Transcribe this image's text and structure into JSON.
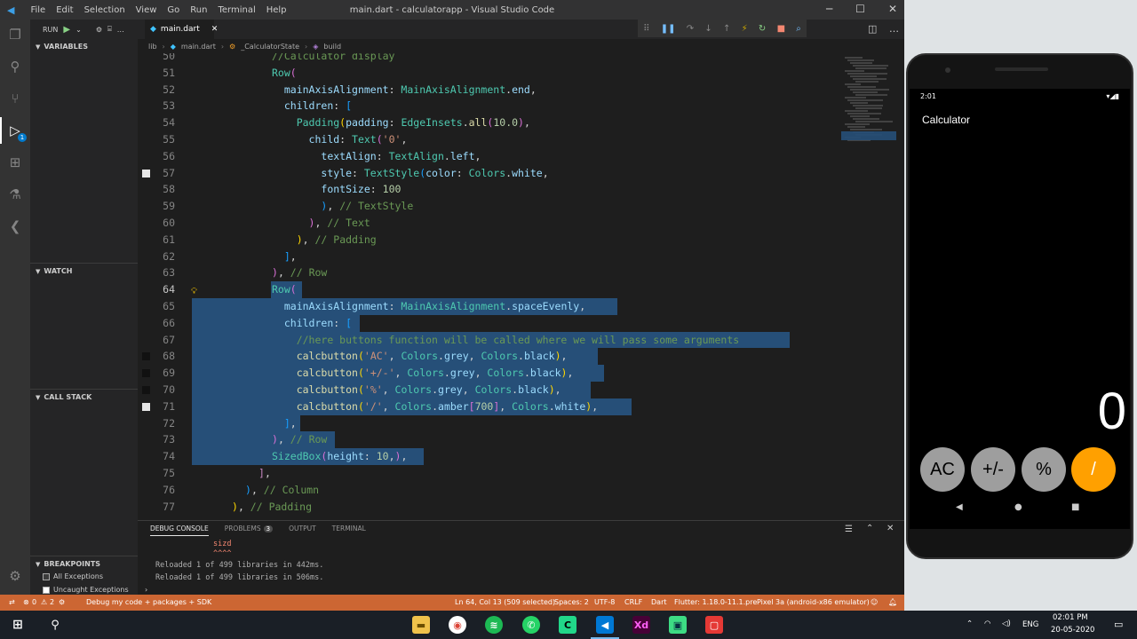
{
  "window": {
    "title": "main.dart - calculatorapp - Visual Studio Code",
    "menu": [
      "File",
      "Edit",
      "Selection",
      "View",
      "Go",
      "Run",
      "Terminal",
      "Help"
    ]
  },
  "sidebar": {
    "run_label": "RUN",
    "variables": "VARIABLES",
    "watch": "WATCH",
    "call_stack": "CALL STACK",
    "breakpoints": "BREAKPOINTS",
    "bp_items": [
      "All Exceptions",
      "Uncaught Exceptions"
    ]
  },
  "editor": {
    "tab": "main.dart",
    "breadcrumb": [
      "lib",
      "main.dart",
      "_CalculatorState",
      "build"
    ]
  },
  "code_lines": [
    {
      "ln": "50",
      "html": "<span class=\"c\">//Calculator display</span>",
      "indent": "          "
    },
    {
      "ln": "51",
      "html": "<span class=\"k\">Row</span><span class=\"br\">(</span>"
    },
    {
      "ln": "52",
      "html": "  <span class=\"p\">mainAxisAlignment</span>: <span class=\"k\">MainAxisAlignment</span>.<span class=\"p\">end</span>,"
    },
    {
      "ln": "53",
      "html": "  <span class=\"p\">children</span>: <span class=\"bb\">[</span>"
    },
    {
      "ln": "54",
      "html": "    <span class=\"k\">Padding</span><span class=\"y\">(</span><span class=\"p\">padding</span>: <span class=\"k\">EdgeInsets</span>.<span class=\"f\">all</span><span class=\"br\">(</span><span class=\"n\">10.0</span><span class=\"br\">)</span>,"
    },
    {
      "ln": "55",
      "html": "      <span class=\"p\">child</span>: <span class=\"k\">Text</span><span class=\"br\">(</span><span class=\"s\">'0'</span>,"
    },
    {
      "ln": "56",
      "html": "        <span class=\"p\">textAlign</span>: <span class=\"k\">TextAlign</span>.<span class=\"p\">left</span>,"
    },
    {
      "ln": "57",
      "html": "        <span class=\"p\">style</span>: <span class=\"k\">TextStyle</span><span class=\"bb\">(</span><span class=\"p\">color</span>: <span class=\"k\">Colors</span>.<span class=\"p\">white</span>,"
    },
    {
      "ln": "58",
      "html": "        <span class=\"p\">fontSize</span>: <span class=\"n\">100</span>"
    },
    {
      "ln": "59",
      "html": "        <span class=\"bb\">)</span>, <span class=\"c\">// TextStyle</span>"
    },
    {
      "ln": "60",
      "html": "      <span class=\"br\">)</span>, <span class=\"c\">// Text</span>"
    },
    {
      "ln": "61",
      "html": "    <span class=\"y\">)</span>, <span class=\"c\">// Padding</span>"
    },
    {
      "ln": "62",
      "html": "  <span class=\"bb\">]</span>,"
    },
    {
      "ln": "63",
      "html": "<span class=\"br\">)</span>, <span class=\"c\">// Row</span>"
    },
    {
      "ln": "64",
      "html": "<span class=\"k\">Row</span><span class=\"br\">(</span>"
    },
    {
      "ln": "65",
      "html": "  <span class=\"p\">mainAxisAlignment</span>: <span class=\"k\">MainAxisAlignment</span>.<span class=\"p\">spaceEvenly</span>,"
    },
    {
      "ln": "66",
      "html": "  <span class=\"p\">children</span>: <span class=\"bb\">[</span>"
    },
    {
      "ln": "67",
      "html": "    <span class=\"c\">//here buttons function will be called where we will pass some arguments</span>"
    },
    {
      "ln": "68",
      "html": "    <span class=\"f\">calcbutton</span><span class=\"y\">(</span><span class=\"s\">'AC'</span>, <span class=\"k\">Colors</span>.<span class=\"p\">grey</span>, <span class=\"k\">Colors</span>.<span class=\"p\">black</span><span class=\"y\">)</span>,"
    },
    {
      "ln": "69",
      "html": "    <span class=\"f\">calcbutton</span><span class=\"y\">(</span><span class=\"s\">'+/-'</span>, <span class=\"k\">Colors</span>.<span class=\"p\">grey</span>, <span class=\"k\">Colors</span>.<span class=\"p\">black</span><span class=\"y\">)</span>,"
    },
    {
      "ln": "70",
      "html": "    <span class=\"f\">calcbutton</span><span class=\"y\">(</span><span class=\"s\">'%'</span>, <span class=\"k\">Colors</span>.<span class=\"p\">grey</span>, <span class=\"k\">Colors</span>.<span class=\"p\">black</span><span class=\"y\">)</span>,"
    },
    {
      "ln": "71",
      "html": "    <span class=\"f\">calcbutton</span><span class=\"y\">(</span><span class=\"s\">'/'</span>, <span class=\"k\">Colors</span>.<span class=\"p\">amber</span><span class=\"br\">[</span><span class=\"n\">700</span><span class=\"br\">]</span>, <span class=\"k\">Colors</span>.<span class=\"p\">white</span><span class=\"y\">)</span>,"
    },
    {
      "ln": "72",
      "html": "  <span class=\"bb\">]</span>,"
    },
    {
      "ln": "73",
      "html": "<span class=\"br\">)</span>, <span class=\"c\">// Row</span>"
    },
    {
      "ln": "74",
      "html": "<span class=\"k\">SizedBox</span><span class=\"br\">(</span><span class=\"p\">height</span>: <span class=\"n\">10</span>,<span class=\"br\">)</span>,"
    },
    {
      "ln": "75",
      "html": "<span class=\"m\">]</span>,"
    },
    {
      "ln": "76",
      "html": "<span class=\"bb\">)</span>, <span class=\"c\">// Column</span>"
    },
    {
      "ln": "77",
      "html": "<span class=\"y\">)</span>, <span class=\"c\">// Padding</span>"
    }
  ],
  "panel": {
    "tabs": [
      "DEBUG CONSOLE",
      "PROBLEMS",
      "OUTPUT",
      "TERMINAL"
    ],
    "problems_count": "3",
    "lines": [
      "sizd",
      "^^^^",
      "Reloaded 1 of 499 libraries in 442ms.",
      "Reloaded 1 of 499 libraries in 506ms."
    ]
  },
  "status": {
    "left": "Debug my code + packages + SDK",
    "errors": "0",
    "warnings": "2",
    "position": "Ln 64, Col 13 (509 selected)",
    "spaces": "Spaces: 2",
    "encoding": "UTF-8",
    "eol": "CRLF",
    "lang": "Dart",
    "flutter": "Flutter: 1.18.0-11.1.pre",
    "device": "Pixel 3a (android-x86 emulator)"
  },
  "phone": {
    "time": "2:01",
    "appbar_title": "Calculator",
    "display": "0",
    "buttons": [
      "AC",
      "+/-",
      "%",
      "/"
    ],
    "colors": {
      "grey": "#9e9e9e",
      "amber": "#ffa000"
    }
  },
  "taskbar": {
    "lang": "ENG",
    "time": "02:01 PM",
    "date": "20-05-2020"
  }
}
